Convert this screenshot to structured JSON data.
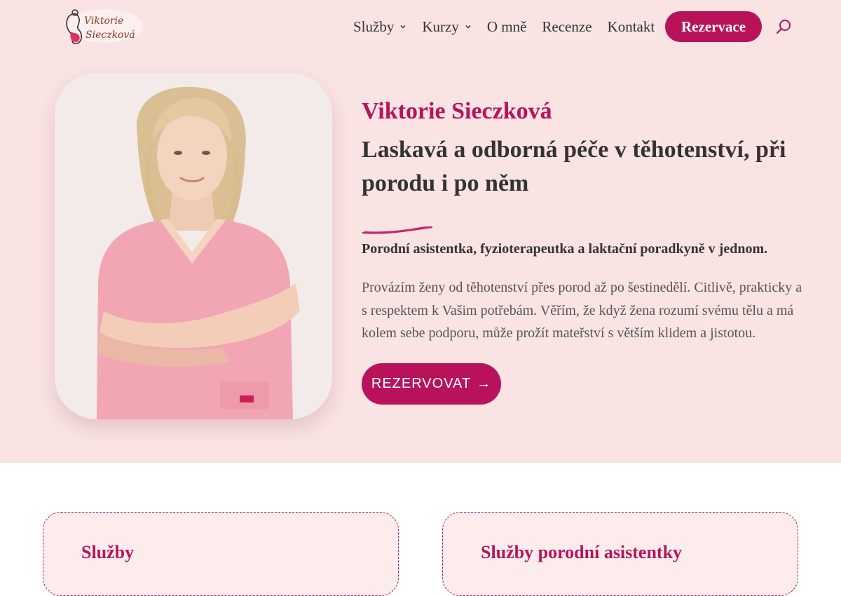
{
  "brand": {
    "logo_line1": "Viktorie",
    "logo_line2": "Sieczková",
    "accent": "#b8135a",
    "hero_background": "#fae3e3"
  },
  "nav": {
    "items": [
      {
        "label": "Služby",
        "has_dropdown": true
      },
      {
        "label": "Kurzy",
        "has_dropdown": true
      },
      {
        "label": "O mně",
        "has_dropdown": false
      },
      {
        "label": "Recenze",
        "has_dropdown": false
      },
      {
        "label": "Kontakt",
        "has_dropdown": false
      }
    ],
    "reserve_label": "Rezervace",
    "search_icon": "search-icon"
  },
  "hero": {
    "name": "Viktorie Sieczková",
    "title": "Laskavá a odborná péče v těhotenství, při porodu i po něm",
    "subtitle": "Porodní asistentka, fyzioterapeutka a laktační poradkyně v jednom.",
    "description": "Provázím ženy od těhotenství přes porod až po šestinedělí. Citlivě, prakticky a s respektem k Vašim potřebám. Věřím, že když žena rozumí svému tělu a má kolem sebe podporu, může prožít mateřství s větším klidem a jistotou.",
    "cta_label": "REZERVOVAT",
    "cta_arrow": "→"
  },
  "cards": [
    {
      "title": "Služby"
    },
    {
      "title": "Služby porodní asistentky"
    }
  ]
}
